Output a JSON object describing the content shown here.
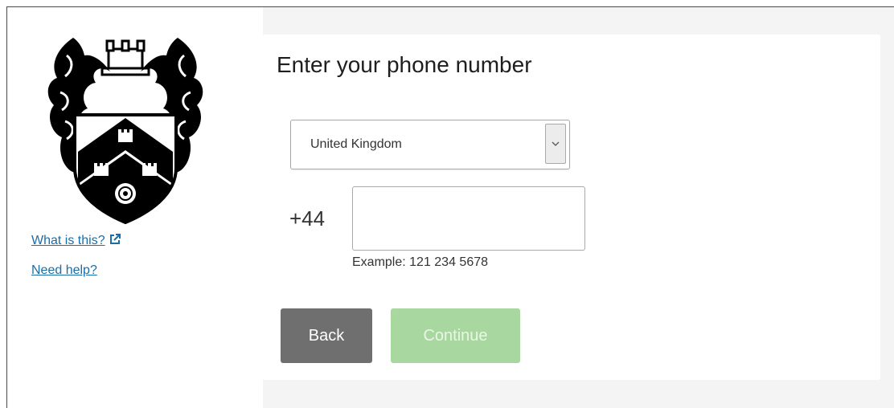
{
  "sidebar": {
    "links": {
      "what_is_this": "What is this?",
      "need_help": "Need help?"
    }
  },
  "form": {
    "title": "Enter your phone number",
    "country_select": {
      "selected": "United Kingdom"
    },
    "dial_code": "+44",
    "phone_input": {
      "value": "",
      "placeholder": ""
    },
    "example_text": "Example: 121 234 5678",
    "buttons": {
      "back": "Back",
      "continue": "Continue"
    }
  },
  "colors": {
    "link": "#1a6ea8",
    "back_button": "#6f6f6f",
    "continue_button_disabled": "#a8d8a0",
    "page_background": "#f4f4f4"
  },
  "icons": {
    "external_link": "external-link-icon",
    "select_arrow": "chevron-down-icon"
  }
}
